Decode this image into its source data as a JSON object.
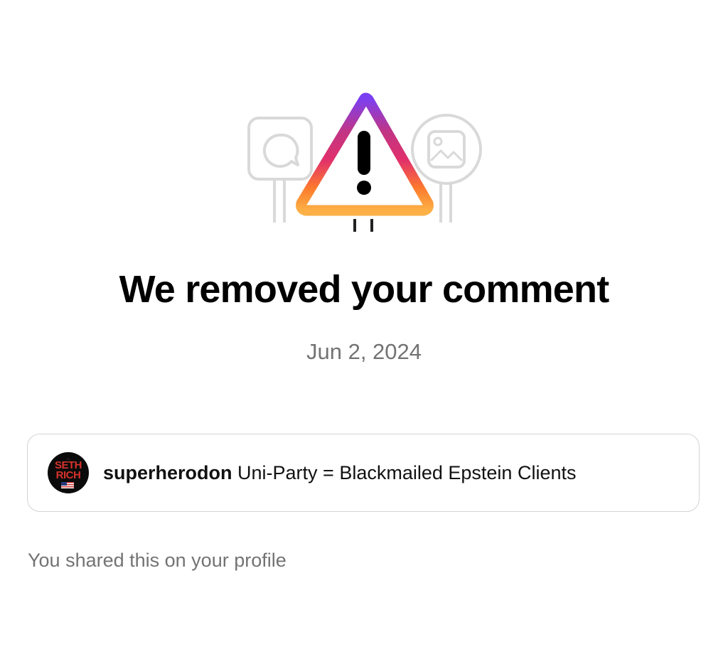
{
  "illustration": {
    "icons": [
      "comment-bubble-icon",
      "warning-triangle-icon",
      "image-icon"
    ],
    "gradient_colors": [
      "#7b3ff2",
      "#c13584",
      "#e1306c",
      "#fd7a2d",
      "#fcb045"
    ]
  },
  "notice": {
    "title": "We removed your comment",
    "date": "Jun 2, 2024"
  },
  "comment": {
    "avatar_text_top": "SETH",
    "avatar_text_bottom": "RICH",
    "username": "superherodon",
    "text": "Uni-Party = Blackmailed Epstein Clients"
  },
  "footer": {
    "note": "You shared this on your profile"
  }
}
